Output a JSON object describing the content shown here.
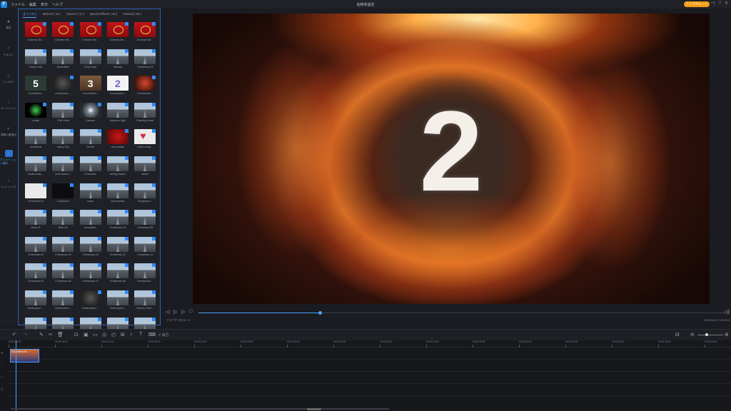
{
  "titlebar": {
    "logo": "F",
    "menu": [
      "ファイル",
      "編集",
      "表示",
      "ヘルプ"
    ],
    "title": "名称未設定",
    "upgrade_label": "アップグレード",
    "more": "⋮",
    "minimize": "—",
    "maximize": "□",
    "close": "✕"
  },
  "rail": [
    {
      "label": "素材",
      "icon": "media-icon",
      "glyph": "▣"
    },
    {
      "label": "テキスト",
      "icon": "text-icon",
      "glyph": "T"
    },
    {
      "label": "フィルター",
      "icon": "filter-icon",
      "glyph": "◎"
    },
    {
      "label": "オーバーレイ",
      "icon": "overlay-icon",
      "glyph": "◇"
    },
    {
      "label": "要素の要追加",
      "icon": "transition-icon",
      "glyph": "⇄"
    },
    {
      "label": "アニメーション素材",
      "icon": "effects-icon",
      "glyph": "▤"
    },
    {
      "label": "ミュージック",
      "icon": "music-icon",
      "glyph": "♫"
    }
  ],
  "library": {
    "tabs": [
      "全て ( 91 )",
      "Stickers ( 16 )",
      "Opener ( 11 )",
      "Special Effects ( 18 )",
      "Festival ( 35 )"
    ],
    "items": [
      {
        "label": "Chinese Ne...",
        "style": "t-red"
      },
      {
        "label": "Chinese Ne...",
        "style": "t-red"
      },
      {
        "label": "Chinese Ne...",
        "style": "t-red"
      },
      {
        "label": "Chinese Ne...",
        "style": "t-red"
      },
      {
        "label": "Chinese Ne...",
        "style": "t-red"
      },
      {
        "label": "Flower rain",
        "style": "t-road"
      },
      {
        "label": "Butterflies",
        "style": "t-road"
      },
      {
        "label": "Girly heart",
        "style": "t-road"
      },
      {
        "label": "Melody",
        "style": "t-road"
      },
      {
        "label": "Christmas-03",
        "style": "t-road"
      },
      {
        "label": "Countdown...",
        "style": "t-num t-num5",
        "glyph": "5"
      },
      {
        "label": "countdown ...",
        "style": "t-dark"
      },
      {
        "label": "Countdown...",
        "style": "t-num t-num3",
        "glyph": "3"
      },
      {
        "label": "Countdown...",
        "style": "t-num t-num2",
        "glyph": "2"
      },
      {
        "label": "Countdown...",
        "style": "t-fire"
      },
      {
        "label": "ready",
        "style": "t-green"
      },
      {
        "label": "Chill Wind",
        "style": "t-road"
      },
      {
        "label": "Cartoon",
        "style": "t-burst"
      },
      {
        "label": "rhythmic light",
        "style": "t-road"
      },
      {
        "label": "Flashing heart",
        "style": "t-road"
      },
      {
        "label": "heartbeat",
        "style": "t-road"
      },
      {
        "label": "starry Sky",
        "style": "t-road"
      },
      {
        "label": "Secret",
        "style": "t-road"
      },
      {
        "label": "rose petals",
        "style": "t-rose"
      },
      {
        "label": "Heart-shap...",
        "style": "t-heart"
      },
      {
        "label": "Heart-shap...",
        "style": "t-road"
      },
      {
        "label": "wind autum...",
        "style": "t-road"
      },
      {
        "label": "Fireworks",
        "style": "t-road"
      },
      {
        "label": "falling leaves",
        "style": "t-road"
      },
      {
        "label": "shiver",
        "style": "t-road"
      },
      {
        "label": "Christmas-01",
        "style": "t-white"
      },
      {
        "label": "Confusion",
        "style": "t-black"
      },
      {
        "label": "snow",
        "style": "t-road"
      },
      {
        "label": "speechless",
        "style": "t-road"
      },
      {
        "label": "Dripping w...",
        "style": "t-road"
      },
      {
        "label": "Bulb-02",
        "style": "t-road"
      },
      {
        "label": "Bulb-01",
        "style": "t-road"
      },
      {
        "label": "sensation",
        "style": "t-road"
      },
      {
        "label": "Christmas-13",
        "style": "t-road"
      },
      {
        "label": "Christmas-05",
        "style": "t-road"
      },
      {
        "label": "Christmas-09",
        "style": "t-road"
      },
      {
        "label": "Christmas-10",
        "style": "t-road"
      },
      {
        "label": "Christmas-04",
        "style": "t-road"
      },
      {
        "label": "Christmas-12",
        "style": "t-road"
      },
      {
        "label": "Christmas-11",
        "style": "t-road"
      },
      {
        "label": "Christmas-02",
        "style": "t-road"
      },
      {
        "label": "Christmas-08",
        "style": "t-road"
      },
      {
        "label": "Christmas-07",
        "style": "t-road"
      },
      {
        "label": "Christmas-06",
        "style": "t-road"
      },
      {
        "label": "Destruction...",
        "style": "t-road"
      },
      {
        "label": "destruction ...",
        "style": "t-road"
      },
      {
        "label": "Destruction...",
        "style": "t-road"
      },
      {
        "label": "Destruction...",
        "style": "t-dark"
      },
      {
        "label": "Destruction...",
        "style": "t-road"
      },
      {
        "label": "Stretch Stret...",
        "style": "t-road"
      },
      {
        "label": "",
        "style": "t-road"
      },
      {
        "label": "",
        "style": "t-road"
      },
      {
        "label": "",
        "style": "t-road"
      },
      {
        "label": "",
        "style": "t-road"
      },
      {
        "label": "",
        "style": "t-road"
      }
    ]
  },
  "preview": {
    "number": "2",
    "aspect_label": "アスペクト比 16 : 9",
    "timecode": "00:00:02:07 / 00:00:0",
    "progress": 0.23
  },
  "player": {
    "prev": "◁",
    "play": "▷",
    "next": "▷",
    "stop": "□",
    "volume": "◁)"
  },
  "toolbar": {
    "undo": "↶",
    "redo": "↷",
    "tools": [
      "✎",
      "✂",
      "🗑",
      "⊡",
      "▣",
      "▭",
      "◎",
      "◴",
      "⊞",
      "♪",
      "T",
      "⌨"
    ],
    "export_label": "出力",
    "export_glyph": "↗",
    "fit_glyph": "⊟",
    "zoom_out": "⊖",
    "zoom_in": "⊕"
  },
  "timeline": {
    "ticks": [
      "00:00:00:00",
      "00:00:16:00",
      "00:00:32:00",
      "00:00:48:00",
      "00:01:04:00",
      "00:01:20:00",
      "00:01:36:00",
      "00:01:52:00",
      "00:02:08:00",
      "00:02:24:00",
      "00:02:40:00",
      "00:02:56:00",
      "00:03:12:00",
      "00:03:28:00",
      "00:03:44:00",
      "00:04:00:00"
    ],
    "clip_label": "Countdown-04",
    "track_icons": [
      "⊞",
      "♪",
      "T",
      "⊡"
    ]
  }
}
